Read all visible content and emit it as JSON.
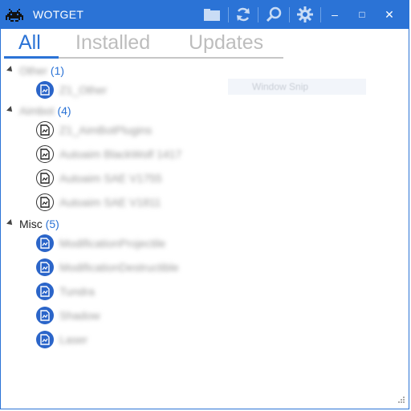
{
  "app": {
    "title": "WOTGET",
    "accent": "#2b73d6"
  },
  "toolbar": {
    "icons": [
      "folder-icon",
      "refresh-icon",
      "search-icon",
      "settings-gear-icon"
    ],
    "window_controls": {
      "minimize": "–",
      "maximize": "□",
      "close": "✕"
    }
  },
  "tabs": [
    {
      "label": "All",
      "active": true
    },
    {
      "label": "Installed",
      "active": false
    },
    {
      "label": "Updates",
      "active": false
    }
  ],
  "groups": [
    {
      "name": "Other",
      "count": "(1)",
      "name_blurred": true,
      "items": [
        {
          "label": "Z1_Other",
          "installed": true
        }
      ]
    },
    {
      "name": "Aimbot",
      "count": "(4)",
      "name_blurred": true,
      "items": [
        {
          "label": "Z1_AimBotPlugins",
          "installed": false
        },
        {
          "label": "Autoaim BlackWolf 1417",
          "installed": false
        },
        {
          "label": "Autoaim SAE V1755",
          "installed": false
        },
        {
          "label": "Autoaim SAE V1811",
          "installed": false
        }
      ]
    },
    {
      "name": "Misc",
      "count": "(5)",
      "name_blurred": false,
      "items": [
        {
          "label": "ModificationProjectile",
          "installed": true
        },
        {
          "label": "ModificationDestructible",
          "installed": true
        },
        {
          "label": "Tundra",
          "installed": true
        },
        {
          "label": "Shadow",
          "installed": true
        },
        {
          "label": "Laser",
          "installed": true
        }
      ]
    }
  ],
  "overlay": {
    "label": "Window Snip"
  }
}
